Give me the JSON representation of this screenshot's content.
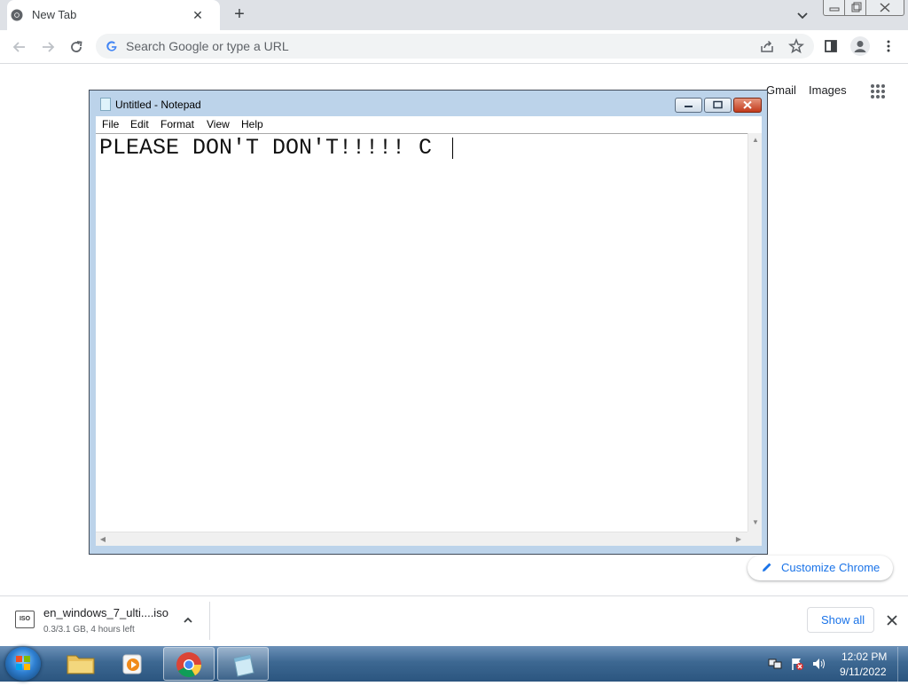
{
  "browser": {
    "tab": {
      "title": "New Tab",
      "close": "✕"
    },
    "new_tab": "+",
    "omnibox": {
      "placeholder": "Search Google or type a URL"
    }
  },
  "ntp": {
    "gmail": "Gmail",
    "images": "Images",
    "customize": "Customize Chrome"
  },
  "notepad": {
    "title": "Untitled - Notepad",
    "menu": [
      "File",
      "Edit",
      "Format",
      "View",
      "Help"
    ],
    "text": "PLEASE DON'T DON'T!!!!! C"
  },
  "download": {
    "filename": "en_windows_7_ulti....iso",
    "status": "0.3/3.1 GB, 4 hours left",
    "show_all": "Show all",
    "icon_label": "ISO"
  },
  "taskbar": {
    "time": "12:02 PM",
    "date": "9/11/2022"
  },
  "colors": {
    "accent": "#1a73e8",
    "taskbar": "#3d6892",
    "notepad_frame": "#bcd3ea"
  }
}
